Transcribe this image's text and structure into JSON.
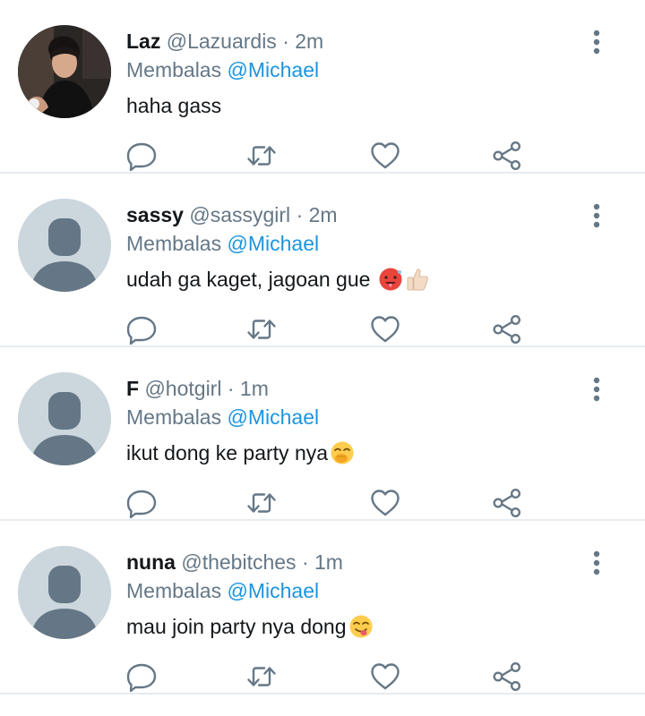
{
  "tweets": [
    {
      "name": "Laz",
      "handle": "@Lazuardis",
      "dot": "·",
      "time": "2m",
      "reply_prefix": "Membalas",
      "reply_mention": "@Michael",
      "text": "haha gass",
      "avatar": "photo",
      "emojis": []
    },
    {
      "name": "sassy",
      "handle": "@sassygirl",
      "dot": "·",
      "time": "2m",
      "reply_prefix": "Membalas",
      "reply_mention": "@Michael",
      "text": "udah ga kaget, jagoan gue ",
      "avatar": "default",
      "emojis": [
        "hot-face-emoji",
        "thumbs-up-emoji"
      ]
    },
    {
      "name": "F",
      "handle": "@hotgirl",
      "dot": "·",
      "time": "1m",
      "reply_prefix": "Membalas",
      "reply_mention": "@Michael",
      "text": "ikut dong ke party nya",
      "avatar": "default",
      "emojis": [
        "hand-over-mouth-emoji"
      ]
    },
    {
      "name": "nuna",
      "handle": "@thebitches",
      "dot": "·",
      "time": "1m",
      "reply_prefix": "Membalas",
      "reply_mention": "@Michael",
      "text": "mau join party nya dong",
      "avatar": "default",
      "emojis": [
        "yum-face-emoji"
      ]
    }
  ],
  "icons": {
    "reply": "reply-icon",
    "retweet": "retweet-icon",
    "like": "heart-icon",
    "share": "share-icon",
    "menu": "more-vertical-icon"
  },
  "colors": {
    "text": "#14171a",
    "secondary": "#657786",
    "mention": "#1b95e0",
    "divider": "#e6ecf0",
    "avatar_bg": "#ccd6dd",
    "avatar_fg": "#657786"
  }
}
